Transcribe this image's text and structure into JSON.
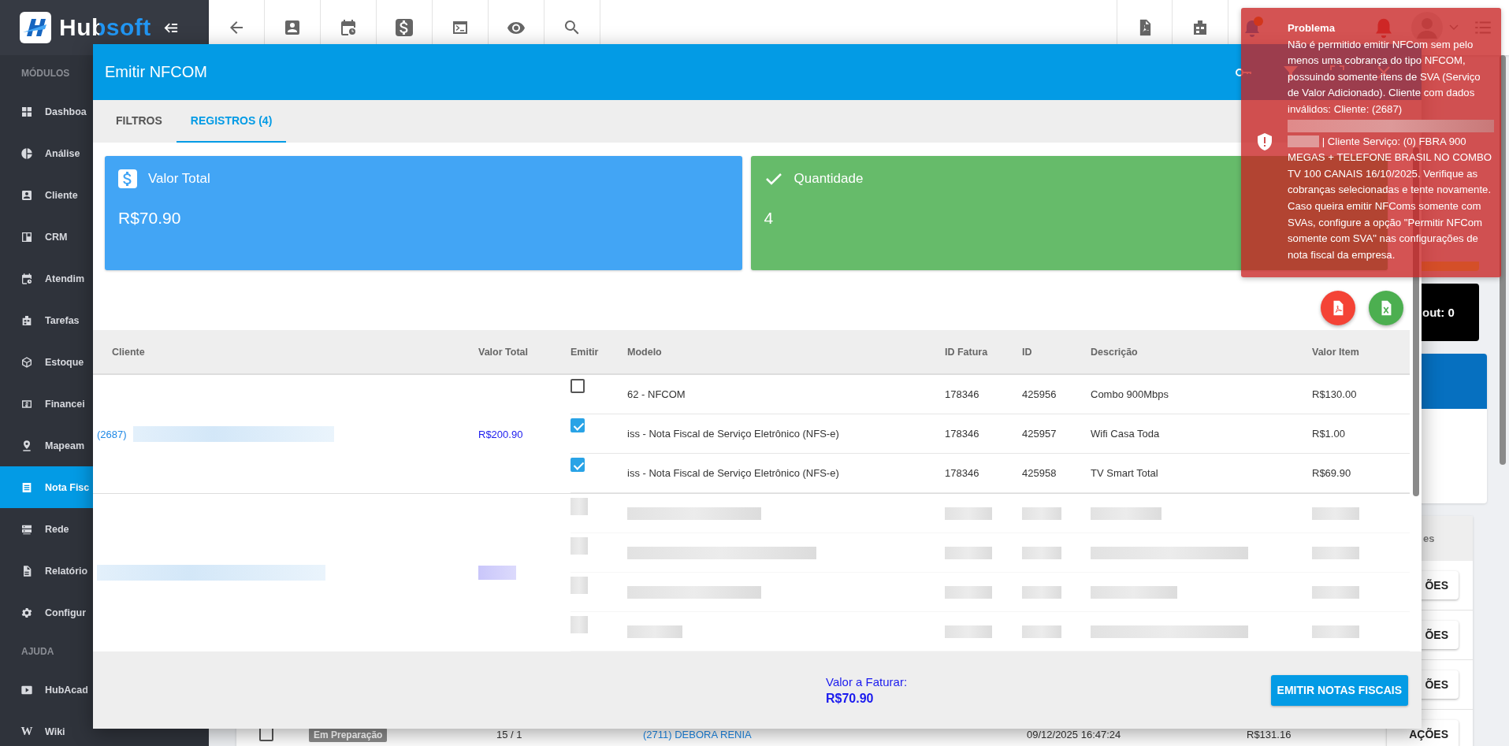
{
  "sidebar": {
    "brand": "Hubsoft",
    "sections": [
      {
        "label": "MÓDULOS",
        "items": [
          {
            "label": "Dashboa",
            "selected": false
          },
          {
            "label": "Análise",
            "selected": false
          },
          {
            "label": "Cliente",
            "selected": false
          },
          {
            "label": "CRM",
            "selected": false
          },
          {
            "label": "Atendim",
            "selected": false
          },
          {
            "label": "Tarefas",
            "selected": false
          },
          {
            "label": "Estoque",
            "selected": false
          },
          {
            "label": "Financei",
            "selected": false
          },
          {
            "label": "Mapeam",
            "selected": false
          },
          {
            "label": "Nota Fisc",
            "selected": true
          },
          {
            "label": "Rede",
            "selected": false
          },
          {
            "label": "Relatório",
            "selected": false
          },
          {
            "label": "Configur",
            "selected": false
          }
        ]
      },
      {
        "label": "AJUDA",
        "items": [
          {
            "label": "HubAcad",
            "selected": false
          },
          {
            "label": "Wiki",
            "selected": false,
            "glyph": "W"
          }
        ]
      }
    ]
  },
  "background": {
    "side_box_text": "out: 0",
    "table": {
      "header_fragment": "es",
      "rows": [
        {
          "action": "ÕES"
        },
        {
          "action": "ÕES"
        },
        {
          "action": "ÕES"
        },
        {
          "checked": false,
          "status": "Em Preparação",
          "count": "15 / 1",
          "client": "(2711) DEBORA RENIA",
          "date": "09/12/2025 16:47:24",
          "value": "R$131.16",
          "action": "AÇÕES"
        }
      ]
    }
  },
  "modal": {
    "title": "Emitir NFCOM",
    "tabs": [
      {
        "label": "FILTROS",
        "selected": false
      },
      {
        "label": "REGISTROS (4)",
        "selected": true
      }
    ],
    "cards": [
      {
        "kind": "currency",
        "title": "Valor Total",
        "value": "R$70.90",
        "color": "#42a5f5"
      },
      {
        "kind": "count",
        "title": "Quantidade",
        "value": "4",
        "color": "#66bb6a"
      }
    ],
    "table": {
      "columns": [
        "Cliente",
        "Valor Total",
        "Emitir",
        "Modelo",
        "ID Fatura",
        "ID",
        "Descrição",
        "Valor Item"
      ],
      "groups": [
        {
          "client_code": "(2687)",
          "total": "R$200.90",
          "items": [
            {
              "checked": false,
              "modelo": "62 - NFCOM",
              "id_fatura": "178346",
              "id": "425956",
              "descricao": "Combo 900Mbps",
              "valor_item": "R$130.00"
            },
            {
              "checked": true,
              "modelo": "iss - Nota Fiscal de Serviço Eletrônico (NFS-e)",
              "id_fatura": "178346",
              "id": "425957",
              "descricao": "Wifi Casa Toda",
              "valor_item": "R$1.00"
            },
            {
              "checked": true,
              "modelo": "iss - Nota Fiscal de Serviço Eletrônico (NFS-e)",
              "id_fatura": "178346",
              "id": "425958",
              "descricao": "TV Smart Total",
              "valor_item": "R$69.90"
            }
          ]
        }
      ]
    },
    "footer": {
      "label": "Valor a Faturar:",
      "amount": "R$70.90",
      "button": "EMITIR NOTAS FISCAIS"
    }
  },
  "toast": {
    "title": "Problema",
    "message_start": "Não é permitido emitir NFCom sem pelo menos uma cobrança do tipo NFCOM, possuindo somente itens de SVA (Serviço de Valor Adicionado). Cliente com dados inválidos: Cliente: (2687)",
    "message_end": "| Cliente Serviço: (0) FBRA 900 MEGAS + TELEFONE BRASIL NO COMBO TV 100 CANAIS 16/10/2025. Verifique as cobranças selecionadas e tente novamente. Caso queira emitir NFComs somente com SVAs, configure a opção \"Permitir NFCom somente com SVA\" nas configurações de nota fiscal da empresa."
  }
}
